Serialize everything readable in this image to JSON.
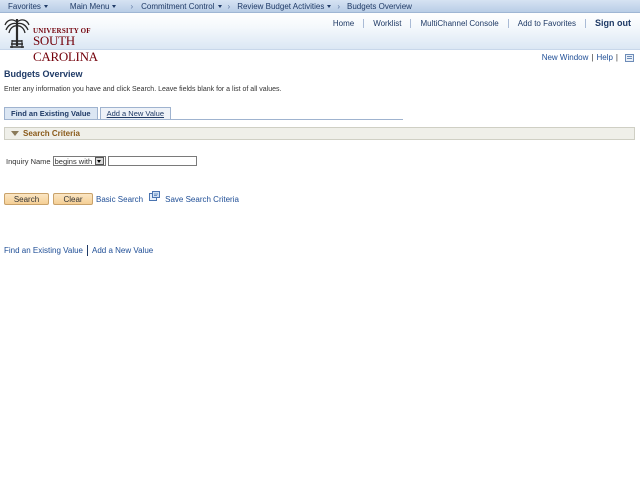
{
  "nav": {
    "items": [
      {
        "label": "Favorites",
        "dropdown": true
      },
      {
        "label": "Main Menu",
        "dropdown": true
      },
      {
        "label": "Commitment Control",
        "dropdown": true
      },
      {
        "label": "Review Budget Activities",
        "dropdown": true
      },
      {
        "label": "Budgets Overview",
        "dropdown": false
      }
    ]
  },
  "header": {
    "logo_small": "UNIVERSITY OF",
    "logo_big": "SOUTH CAROLINA",
    "links": [
      "Home",
      "Worklist",
      "MultiChannel Console",
      "Add to Favorites"
    ],
    "signout": "Sign out"
  },
  "util": {
    "new_window": "New Window",
    "help": "Help"
  },
  "page": {
    "title": "Budgets Overview",
    "instructions": "Enter any information you have and click Search. Leave fields blank for a list of all values."
  },
  "tabs": {
    "find": "Find an Existing Value",
    "add": "Add a New Value"
  },
  "criteria": {
    "header": "Search Criteria",
    "inquiry_label": "Inquiry Name",
    "operator": "begins with",
    "inquiry_value": ""
  },
  "buttons": {
    "search": "Search",
    "clear": "Clear",
    "basic_search": "Basic Search",
    "save_criteria": "Save Search Criteria"
  },
  "bottom": {
    "find": "Find an Existing Value",
    "add": "Add a New Value"
  },
  "colors": {
    "nav_bg": "#c7d8ee",
    "brand": "#73000a",
    "link": "#1f4e96",
    "button": "#f5cf95"
  }
}
